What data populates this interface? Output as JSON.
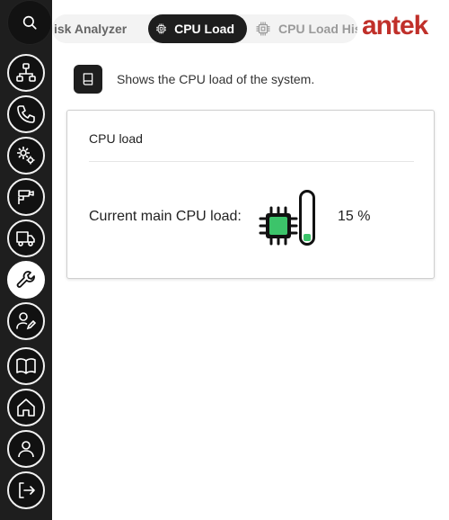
{
  "sidebar": {
    "items": [
      {
        "icon": "network-icon"
      },
      {
        "icon": "phone-icon"
      },
      {
        "icon": "gears-icon"
      },
      {
        "icon": "camera-icon"
      },
      {
        "icon": "truck-icon"
      },
      {
        "icon": "wrench-icon",
        "active": true
      },
      {
        "icon": "user-pen-icon"
      },
      {
        "icon": "book-icon"
      },
      {
        "icon": "home-icon"
      },
      {
        "icon": "user-icon"
      },
      {
        "icon": "logout-icon"
      }
    ]
  },
  "tabs": [
    {
      "label": "isk Analyzer"
    },
    {
      "label": "CPU Load"
    },
    {
      "label": "CPU Load Hist"
    }
  ],
  "logo": "antek",
  "info": {
    "text": "Shows the CPU load of the system."
  },
  "card": {
    "title": "CPU load",
    "load_label": "Current main CPU load:",
    "load_value": "15 %",
    "load_fraction": 0.15
  },
  "colors": {
    "accent_green": "#3cc46a",
    "brand_red": "#c0302a",
    "sidebar_bg": "#1e1e1e"
  }
}
